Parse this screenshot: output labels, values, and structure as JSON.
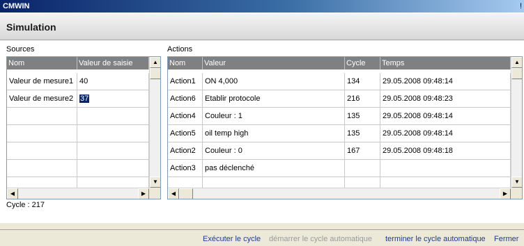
{
  "window": {
    "title": "CMWIN",
    "title_right": "!"
  },
  "header": {
    "title": "Simulation"
  },
  "sources": {
    "label": "Sources",
    "columns": [
      "Nom",
      "Valeur de saisie"
    ],
    "rows": [
      [
        "Valeur de mesure1",
        "40"
      ],
      [
        "Valeur de mesure2",
        "37"
      ],
      [
        "",
        ""
      ],
      [
        "",
        ""
      ],
      [
        "",
        ""
      ],
      [
        "",
        ""
      ],
      [
        "",
        ""
      ]
    ]
  },
  "actions": {
    "label": "Actions",
    "columns": [
      "Nom",
      "Valeur",
      "Cycle",
      "Temps"
    ],
    "rows": [
      [
        "Action1",
        " ON 4,000",
        "134",
        "29.05.2008 09:48:14"
      ],
      [
        "Action6",
        "Etablir protocole",
        "216",
        "29.05.2008 09:48:23"
      ],
      [
        "Action4",
        "Couleur : 1",
        "135",
        "29.05.2008 09:48:14"
      ],
      [
        "Action5",
        "oil temp high",
        "135",
        "29.05.2008 09:48:14"
      ],
      [
        "Action2",
        "Couleur : 0",
        "167",
        "29.05.2008 09:48:18"
      ],
      [
        "Action3",
        "pas déclenché",
        "",
        ""
      ],
      [
        "",
        "",
        "",
        ""
      ]
    ]
  },
  "status": {
    "cycle_text": "Cycle : 217"
  },
  "footer": {
    "execute": "Exécuter le cycle",
    "start_auto": "démarrer le cycle automatique",
    "stop_auto": "terminer le cycle automatique",
    "close": "Fermer"
  },
  "icons": {
    "scroll_up": "▲",
    "scroll_down": "▼",
    "scroll_left": "◀",
    "scroll_right": "▶"
  }
}
